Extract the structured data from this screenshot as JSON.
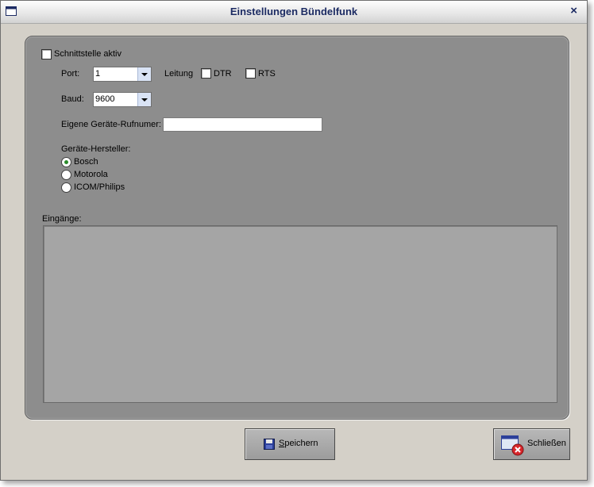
{
  "window": {
    "title": "Einstellungen Bündelfunk",
    "close_label": "×"
  },
  "interface": {
    "active_label": "Schnittstelle aktiv",
    "active_checked": false,
    "port_label": "Port:",
    "port_value": "1",
    "leitung_label": "Leitung",
    "dtr_label": "DTR",
    "dtr_checked": false,
    "rts_label": "RTS",
    "rts_checked": false,
    "baud_label": "Baud:",
    "baud_value": "9600",
    "phone_label": "Eigene Geräte-Rufnumer:",
    "phone_value": ""
  },
  "manufacturer": {
    "label": "Geräte-Hersteller:",
    "options": [
      "Bosch",
      "Motorola",
      "ICOM/Philips"
    ],
    "selected": "Bosch"
  },
  "inputs": {
    "label": "Eingänge:"
  },
  "buttons": {
    "save_label_underlined": "S",
    "save_label_rest": "peichern",
    "close_label": "Schließen"
  },
  "colors": {
    "panel": "#8d8d8d",
    "title_text": "#1c2b63",
    "radio_selected": "#2a8b2a"
  }
}
